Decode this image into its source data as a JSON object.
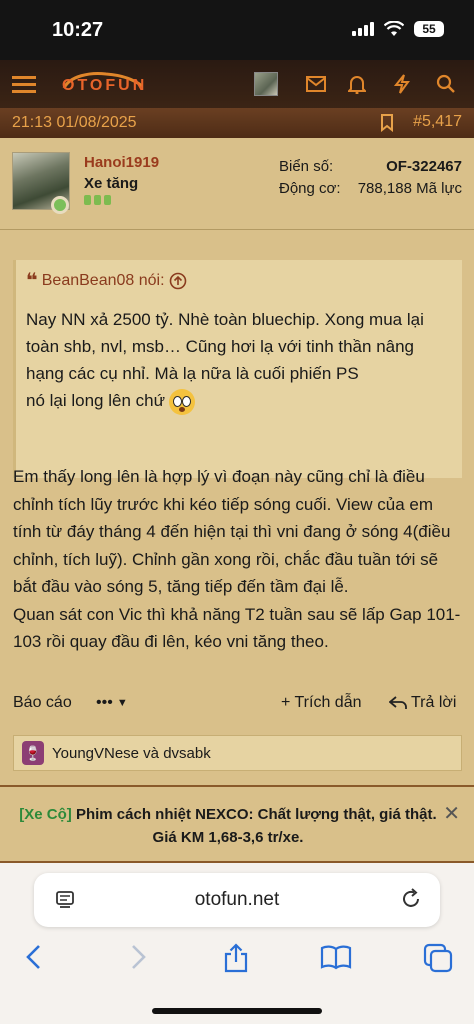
{
  "status": {
    "time": "10:27",
    "battery": "55"
  },
  "nav": {
    "logo": "OTOFUN"
  },
  "post": {
    "date": "21:13 01/08/2025",
    "number": "#5,417",
    "username": "Hanoi1919",
    "user_title": "Xe tăng",
    "plate_label": "Biển số:",
    "plate_value": "OF-322467",
    "engine_label": "Động cơ:",
    "engine_value": "788,188 Mã lực",
    "quote_author": "BeanBean08 nói:",
    "quote_line1": "Nay NN xả 2500 tỷ. Nhè toàn bluechip. Xong mua lại toàn shb, nvl, msb… Cũng hơi lạ với tinh thần nâng hạng các cụ nhỉ. Mà lạ nữa là cuối phiến PS",
    "quote_line2": "nó lại long lên chứ",
    "body_line1": "Em thấy long lên là hợp lý vì đoạn này cũng chỉ là điều chỉnh tích lũy trước khi kéo tiếp sóng cuối. View của em tính từ đáy tháng 4 đến hiện tại thì vni đang ở sóng 4(điều chỉnh, tích luỹ). Chỉnh gần xong rồi, chắc đầu tuần tới sẽ bắt đầu vào sóng 5, tăng tiếp đến tầm đại lễ.",
    "body_line2": "Quan sát con Vic thì khả năng T2 tuần sau sẽ lấp Gap 101-103 rồi quay đầu đi lên, kéo vni tăng theo.",
    "report_label": "Báo cáo",
    "more_label": "•••",
    "quote_button": "+ Trích dẫn",
    "reply_button": "Trả lời",
    "likes_text": "YoungVNese và dvsabk"
  },
  "ad": {
    "tag": "[Xe Cộ]",
    "text": " Phim cách nhiệt NEXCO: Chất lượng thật, giá thật. Giá KM 1,68-3,6 tr/xe."
  },
  "browser": {
    "url": "otofun.net"
  },
  "colors": {
    "accent": "#e0862b",
    "header_bg": "#3b2415",
    "page_bg": "#d9c08a",
    "link_blue": "#2a6fd6"
  }
}
